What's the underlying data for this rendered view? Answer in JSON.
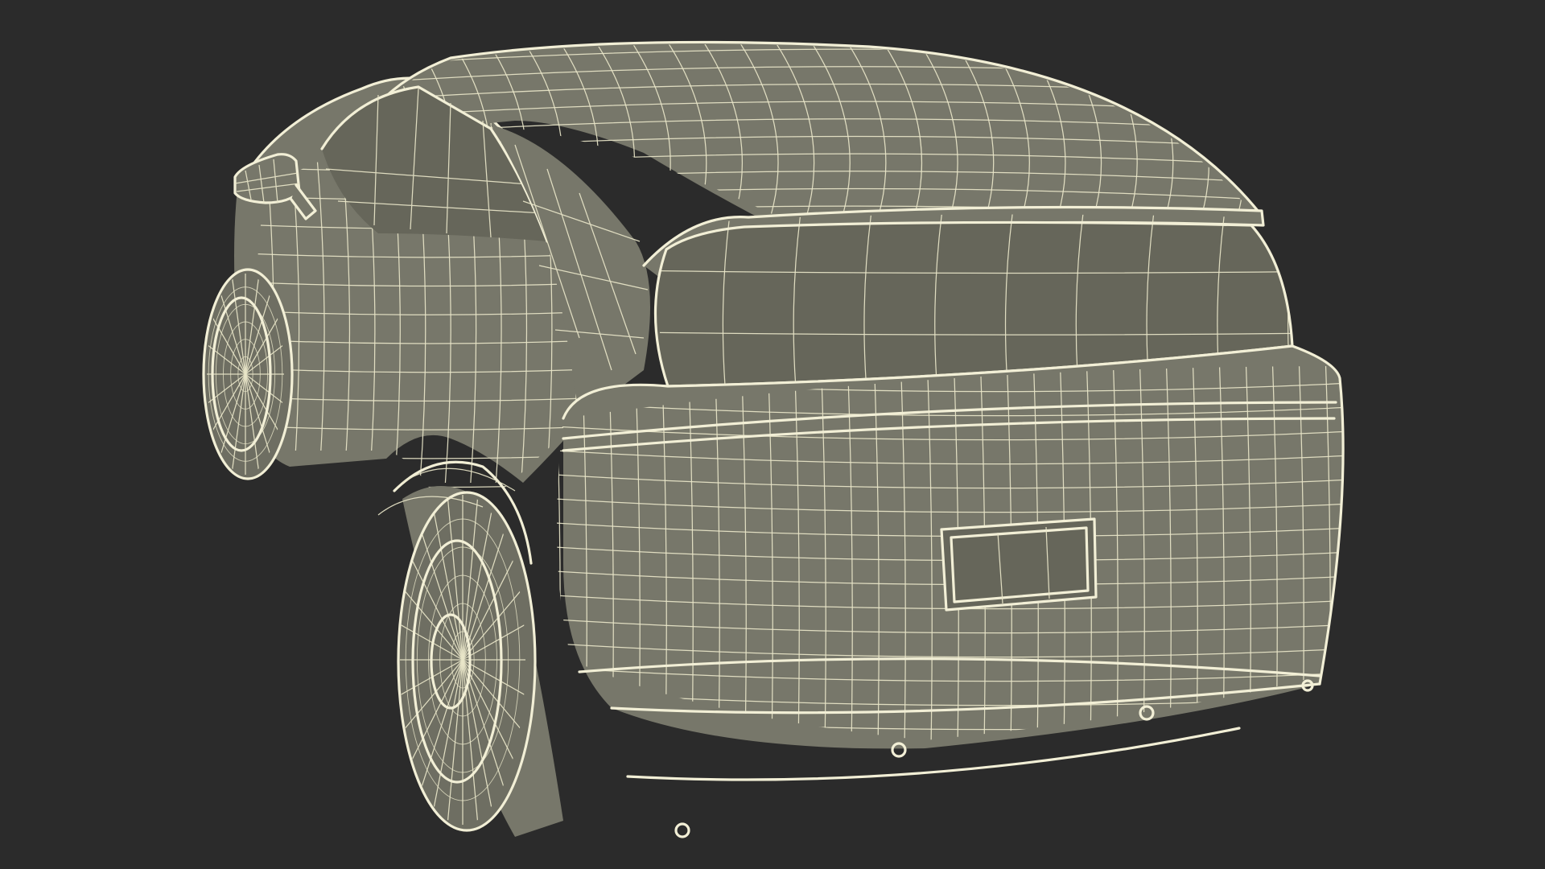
{
  "scene": {
    "subject": "suv-wireframe",
    "colors": {
      "background": "#2b2b2b",
      "surface": "#77776a",
      "wire": "#ece9cf"
    }
  }
}
